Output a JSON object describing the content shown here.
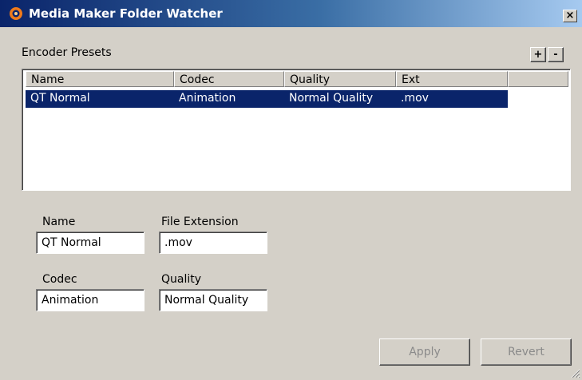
{
  "window": {
    "title": "Media Maker Folder Watcher",
    "close_label": "×"
  },
  "presets": {
    "label": "Encoder Presets",
    "add_label": "+",
    "remove_label": "-",
    "columns": [
      "Name",
      "Codec",
      "Quality",
      "Ext"
    ],
    "rows": [
      {
        "name": "QT Normal",
        "codec": "Animation",
        "quality": "Normal Quality",
        "ext": ".mov",
        "selected": true
      }
    ]
  },
  "form": {
    "name_label": "Name",
    "name_value": "QT Normal",
    "ext_label": "File Extension",
    "ext_value": ".mov",
    "codec_label": "Codec",
    "codec_value": "Animation",
    "quality_label": "Quality",
    "quality_value": "Normal Quality"
  },
  "buttons": {
    "apply": "Apply",
    "revert": "Revert"
  },
  "colors": {
    "selection": "#0a246a",
    "face": "#d4d0c8",
    "accent_icon": "#f07a1a"
  }
}
